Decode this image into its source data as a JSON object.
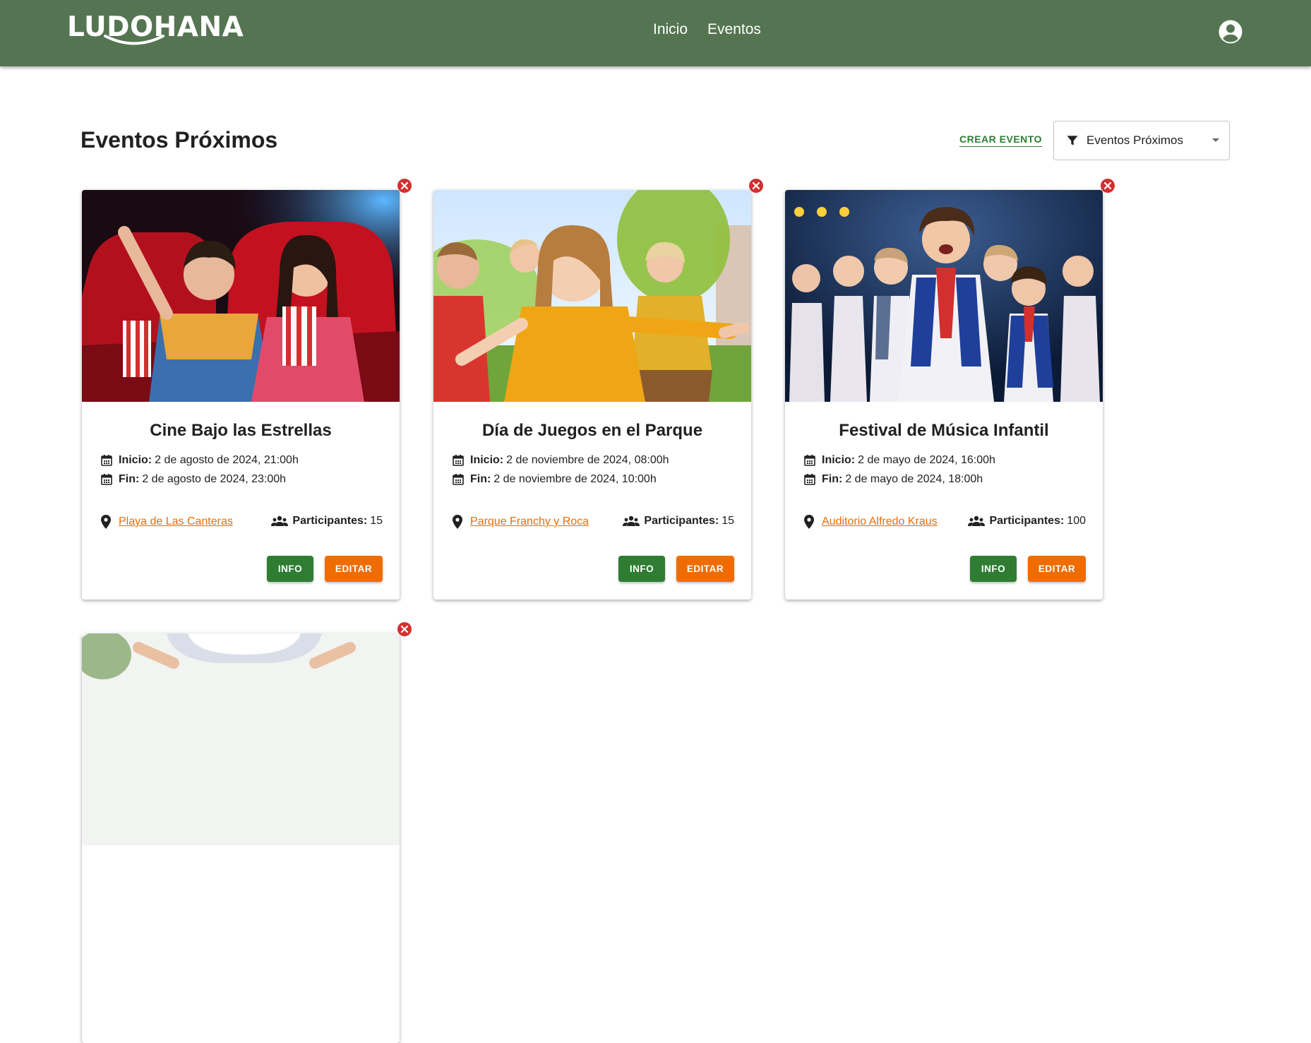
{
  "brand": {
    "name": "LUDOHANA",
    "color": "#557552"
  },
  "nav": {
    "items": [
      {
        "label": "Inicio"
      },
      {
        "label": "Eventos"
      }
    ]
  },
  "header": {
    "account_icon": "account-circle-icon"
  },
  "page": {
    "title": "Eventos Próximos",
    "create_label": "CREAR EVENTO"
  },
  "filter": {
    "value": "Eventos Próximos",
    "icon": "filter-icon"
  },
  "labels": {
    "start": "Inicio:",
    "end": "Fin:",
    "participants": "Participantes:",
    "info": "INFO",
    "edit": "EDITAR"
  },
  "colors": {
    "info": "#2e7d32",
    "edit": "#ef6c00",
    "delete": "#d32f2f",
    "link": "#ef6c00"
  },
  "events": [
    {
      "title": "Cine Bajo las Estrellas",
      "start": "2 de agosto de 2024, 21:00h",
      "end": "2 de agosto de 2024, 23:00h",
      "location": "Playa de Las Canteras",
      "participants": "15",
      "image": "cinema-kids-photo"
    },
    {
      "title": "Día de Juegos en el Parque",
      "start": "2 de noviembre de 2024, 08:00h",
      "end": "2 de noviembre de 2024, 10:00h",
      "location": "Parque Franchy y Roca",
      "participants": "15",
      "image": "park-kids-photo"
    },
    {
      "title": "Festival de Música Infantil",
      "start": "2 de mayo de 2024, 16:00h",
      "end": "2 de mayo de 2024, 18:00h",
      "location": "Auditorio Alfredo Kraus",
      "participants": "100",
      "image": "music-kids-photo"
    },
    {
      "title": "",
      "image": "partial-event-photo"
    }
  ]
}
